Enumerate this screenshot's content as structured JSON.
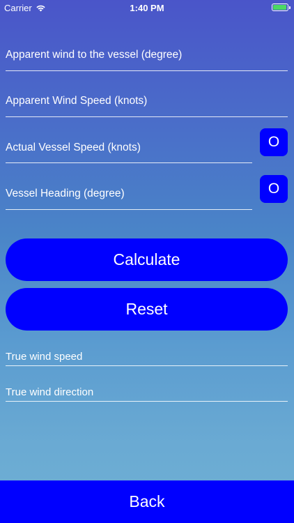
{
  "status_bar": {
    "carrier": "Carrier",
    "time": "1:40 PM",
    "battery_color": "#4cd964"
  },
  "form": {
    "apparent_wind_direction_placeholder": "Apparent wind to the vessel (degree)",
    "apparent_wind_speed_placeholder": "Apparent Wind Speed (knots)",
    "vessel_speed_placeholder": "Actual Vessel Speed (knots)",
    "vessel_heading_placeholder": "Vessel Heading (degree)",
    "toggle_label": "O"
  },
  "actions": {
    "calculate_label": "Calculate",
    "reset_label": "Reset",
    "back_label": "Back"
  },
  "results": {
    "true_wind_speed_label": "True wind speed",
    "true_wind_direction_label": "True wind direction"
  },
  "colors": {
    "accent": "#0000ff",
    "text": "#ffffff"
  },
  "icons": {
    "wifi": "wifi-icon",
    "battery": "battery-icon"
  }
}
